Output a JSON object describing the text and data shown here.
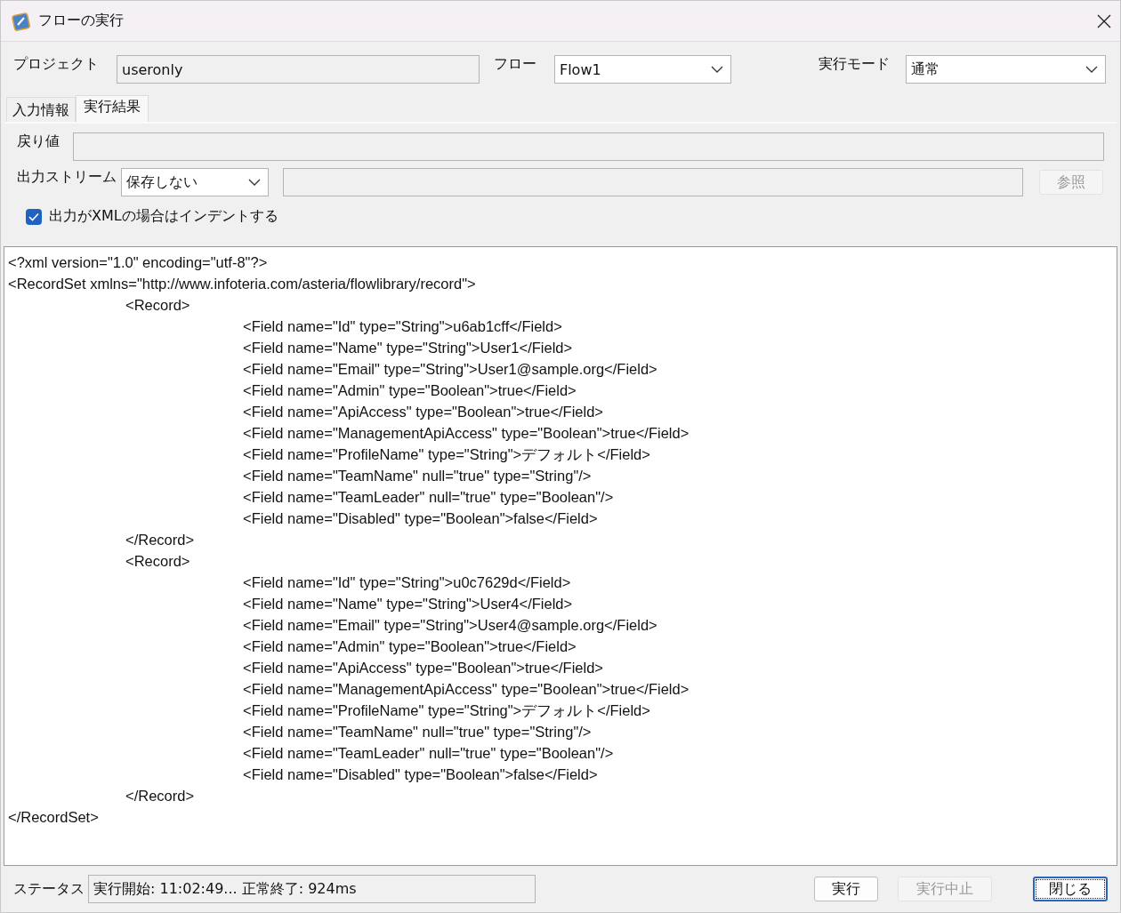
{
  "window": {
    "title": "フローの実行"
  },
  "header": {
    "project": {
      "label": "プロジェクト",
      "value": "useronly"
    },
    "flow": {
      "label": "フロー",
      "value": "Flow1"
    },
    "mode": {
      "label": "実行モード",
      "value": "通常"
    }
  },
  "tabs": [
    {
      "label": "入力情報",
      "selected": false
    },
    {
      "label": "実行結果",
      "selected": true
    }
  ],
  "result": {
    "return_value": {
      "label": "戻り値"
    },
    "output_stream": {
      "label": "出力ストリーム",
      "value": "保存しない"
    },
    "browse_button": {
      "label": "参照",
      "disabled": true
    },
    "indent_xml": {
      "label": "出力がXMLの場合はインデントする",
      "checked": true
    }
  },
  "output": [
    {
      "text": "<?xml version=\"1.0\" encoding=\"utf-8\"?>"
    },
    {
      "text": "<RecordSet xmlns=\"http://www.infoteria.com/asteria/flowlibrary/record\">",
      "children": [
        {
          "text": "<Record>",
          "children": [
            {
              "text": "<Field name=\"Id\" type=\"String\">u6ab1cff</Field>"
            },
            {
              "text": "<Field name=\"Name\" type=\"String\">User1</Field>"
            },
            {
              "text": "<Field name=\"Email\" type=\"String\">User1@sample.org</Field>"
            },
            {
              "text": "<Field name=\"Admin\" type=\"Boolean\">true</Field>"
            },
            {
              "text": "<Field name=\"ApiAccess\" type=\"Boolean\">true</Field>"
            },
            {
              "text": "<Field name=\"ManagementApiAccess\" type=\"Boolean\">true</Field>"
            },
            {
              "text": "<Field name=\"ProfileName\" type=\"String\">デフォルト</Field>"
            },
            {
              "text": "<Field name=\"TeamName\" null=\"true\" type=\"String\"/>"
            },
            {
              "text": "<Field name=\"TeamLeader\" null=\"true\" type=\"Boolean\"/>"
            },
            {
              "text": "<Field name=\"Disabled\" type=\"Boolean\">false</Field>"
            }
          ]
        },
        {
          "text": "</Record>"
        },
        {
          "text": "<Record>",
          "children": [
            {
              "text": "<Field name=\"Id\" type=\"String\">u0c7629d</Field>"
            },
            {
              "text": "<Field name=\"Name\" type=\"String\">User4</Field>"
            },
            {
              "text": "<Field name=\"Email\" type=\"String\">User4@sample.org</Field>"
            },
            {
              "text": "<Field name=\"Admin\" type=\"Boolean\">true</Field>"
            },
            {
              "text": "<Field name=\"ApiAccess\" type=\"Boolean\">true</Field>"
            },
            {
              "text": "<Field name=\"ManagementApiAccess\" type=\"Boolean\">true</Field>"
            },
            {
              "text": "<Field name=\"ProfileName\" type=\"String\">デフォルト</Field>"
            },
            {
              "text": "<Field name=\"TeamName\" null=\"true\" type=\"String\"/>"
            },
            {
              "text": "<Field name=\"TeamLeader\" null=\"true\" type=\"Boolean\"/>"
            },
            {
              "text": "<Field name=\"Disabled\" type=\"Boolean\">false</Field>"
            }
          ]
        },
        {
          "text": "</Record>"
        }
      ]
    },
    {
      "text": "</RecordSet>"
    }
  ],
  "status_bar": {
    "label": "ステータス",
    "value": "実行開始: 11:02:49... 正常終了: 924ms"
  },
  "buttons": [
    {
      "label": "実行",
      "disabled": false,
      "default": false
    },
    {
      "label": "実行中止",
      "disabled": true,
      "default": false
    },
    {
      "label": "閉じる",
      "disabled": false,
      "default": true
    }
  ]
}
